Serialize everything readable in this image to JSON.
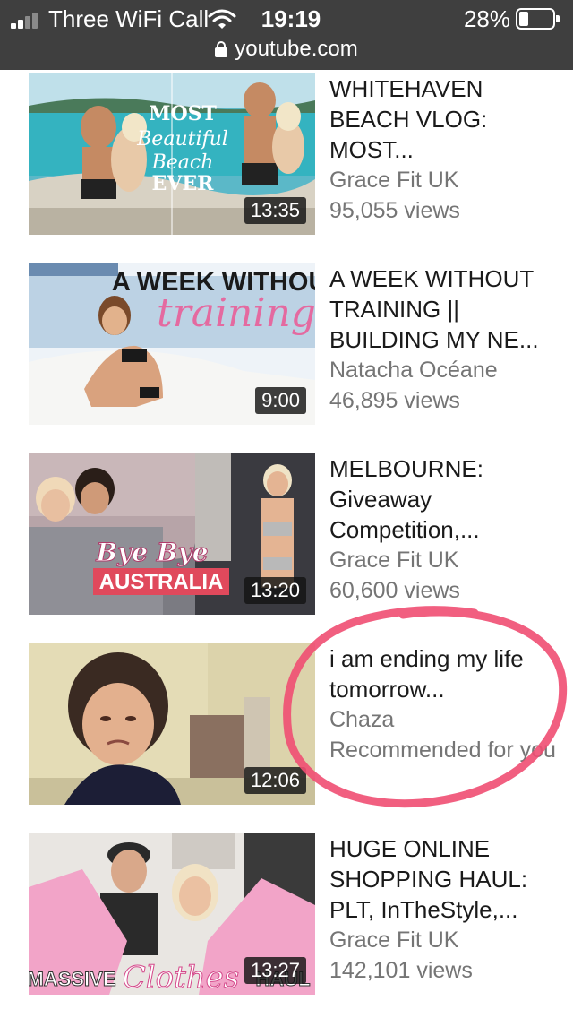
{
  "status_bar": {
    "carrier": "Three WiFi Call",
    "time": "19:19",
    "battery_percent": "28%",
    "battery_level": 0.28,
    "signal_bars_filled": 2,
    "signal_bars_total": 4,
    "icons": [
      "signal-bars-icon",
      "wifi-icon",
      "battery-icon",
      "lock-icon"
    ]
  },
  "address_bar": {
    "url": "youtube.com"
  },
  "videos": [
    {
      "title": "WHITEHAVEN BEACH VLOG: MOST...",
      "channel": "Grace Fit UK",
      "views": "95,055 views",
      "duration": "13:35",
      "thumbnail_text": [
        "MOST",
        "Beautiful",
        "Beach",
        "EVER"
      ]
    },
    {
      "title": "A WEEK WITHOUT TRAINING || BUILDING MY NE...",
      "channel": "Natacha Océane",
      "views": "46,895 views",
      "duration": "9:00",
      "thumbnail_text": [
        "A WEEK WITHOUT",
        "training"
      ]
    },
    {
      "title": "MELBOURNE: Giveaway Competition,...",
      "channel": "Grace Fit UK",
      "views": "60,600 views",
      "duration": "13:20",
      "thumbnail_text": [
        "Bye Bye",
        "AUSTRALIA"
      ]
    },
    {
      "title": "i am ending my life tomorrow...",
      "channel": "Chaza",
      "views": "Recommended for you",
      "duration": "12:06",
      "thumbnail_text": []
    },
    {
      "title": "HUGE ONLINE SHOPPING HAUL: PLT, InTheStyle,...",
      "channel": "Grace Fit UK",
      "views": "142,101 views",
      "duration": "13:27",
      "thumbnail_text": [
        "MASSIVE",
        "Clothes",
        "HAUL"
      ]
    }
  ],
  "colors": {
    "status_bar_bg": "#3f3f3f",
    "title_text": "#1a1a1a",
    "secondary_text": "#757575",
    "annotation_circle": "#f04e72"
  }
}
